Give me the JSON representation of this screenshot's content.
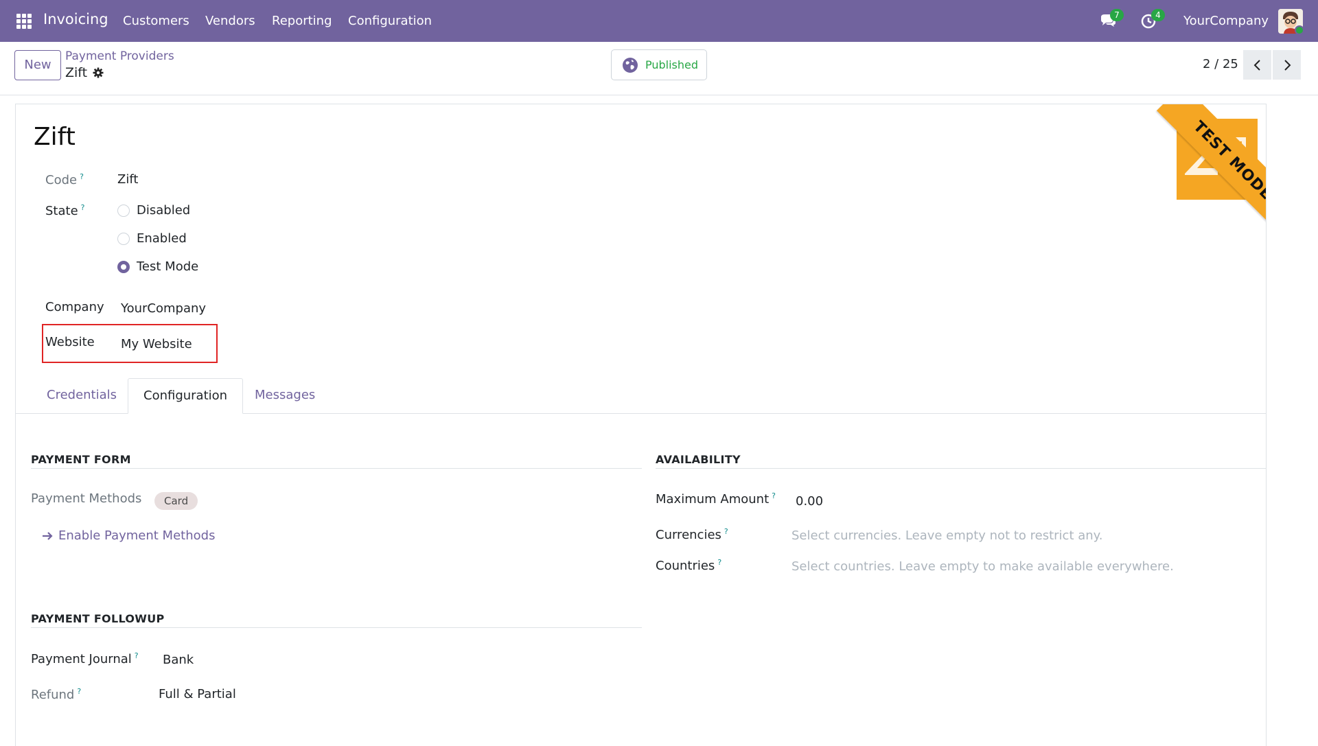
{
  "navbar": {
    "app_name": "Invoicing",
    "menu": [
      "Customers",
      "Vendors",
      "Reporting",
      "Configuration"
    ],
    "messages_count": "7",
    "activities_count": "4",
    "company": "YourCompany",
    "bg_color": "#71639e"
  },
  "control_panel": {
    "new_label": "New",
    "breadcrumb": "Payment Providers",
    "record_name": "Zift",
    "published_label": "Published",
    "pager": "2 / 25"
  },
  "form": {
    "title": "Zift",
    "code_label": "Code",
    "code_value": "Zift",
    "state_label": "State",
    "state_options": [
      "Disabled",
      "Enabled",
      "Test Mode"
    ],
    "state_selected": "Test Mode",
    "company_label": "Company",
    "company_value": "YourCompany",
    "website_label": "Website",
    "website_value": "My Website",
    "ribbon_text": "TEST MODE",
    "ribbon_color": "#f5a623"
  },
  "tabs": [
    "Credentials",
    "Configuration",
    "Messages"
  ],
  "active_tab": "Configuration",
  "payment_form": {
    "title": "PAYMENT FORM",
    "methods_label": "Payment Methods",
    "methods_tag": "Card",
    "enable_link": "Enable Payment Methods"
  },
  "availability": {
    "title": "AVAILABILITY",
    "max_amount_label": "Maximum Amount",
    "max_amount_value": "0.00",
    "currencies_label": "Currencies",
    "currencies_placeholder": "Select currencies. Leave empty not to restrict any.",
    "countries_label": "Countries",
    "countries_placeholder": "Select countries. Leave empty to make available everywhere."
  },
  "payment_followup": {
    "title": "PAYMENT FOLLOWUP",
    "journal_label": "Payment Journal",
    "journal_value": "Bank",
    "refund_label": "Refund",
    "refund_value": "Full & Partial"
  },
  "help_mark": "?"
}
